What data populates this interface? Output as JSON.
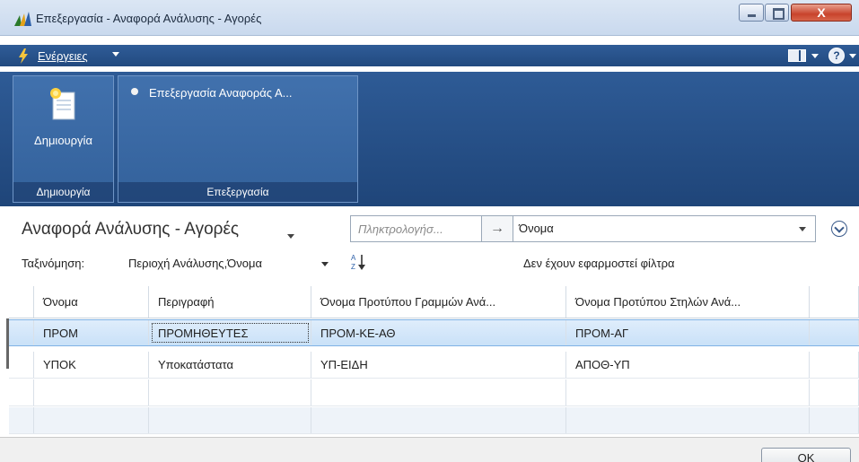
{
  "window": {
    "title": "Επεξεργασία - Αναφορά Ανάλυσης - Αγορές",
    "icon": "dynamics-nav-icon"
  },
  "actions_bar": {
    "menu_label": "Ενέργειες",
    "icons": [
      "bolt-icon",
      "layout-icon",
      "help-icon"
    ]
  },
  "ribbon": {
    "groups": [
      {
        "footer": "Δημιουργία",
        "items": [
          {
            "label": "Δημιουργία",
            "icon": "new-document-icon"
          }
        ]
      },
      {
        "footer": "Επεξεργασία",
        "items": [
          {
            "label": "Επεξεργασία Αναφοράς Α...",
            "icon": "bullet-icon"
          }
        ]
      }
    ]
  },
  "list": {
    "title": "Αναφορά Ανάλυσης - Αγορές",
    "search_placeholder": "Πληκτρολογήσ...",
    "search_field": "Όνομα",
    "sort_label": "Ταξινόμηση:",
    "sort_value": "Περιοχή Ανάλυσης,Όνομα",
    "filter_status": "Δεν έχουν εφαρμοστεί φίλτρα"
  },
  "grid": {
    "columns": [
      "Όνομα",
      "Περιγραφή",
      "Όνομα Προτύπου Γραμμών Ανά...",
      "Όνομα Προτύπου Στηλών Ανά..."
    ],
    "rows": [
      {
        "name": "ΠΡΟΜ",
        "description": "ΠΡΟΜΗΘΕΥΤΕΣ",
        "row_template": "ΠΡΟΜ-ΚΕ-ΑΘ",
        "column_template": "ΠΡΟΜ-ΑΓ"
      },
      {
        "name": "ΥΠΟΚ",
        "description": "Υποκατάστατα",
        "row_template": "ΥΠ-ΕΙΔΗ",
        "column_template": "ΑΠΟΘ-ΥΠ"
      }
    ]
  },
  "footer": {
    "ok_label": "OK"
  },
  "colors": {
    "ribbon": "#2e5b96",
    "selected_row": "#cfe4f9",
    "close_button": "#c8432c"
  }
}
